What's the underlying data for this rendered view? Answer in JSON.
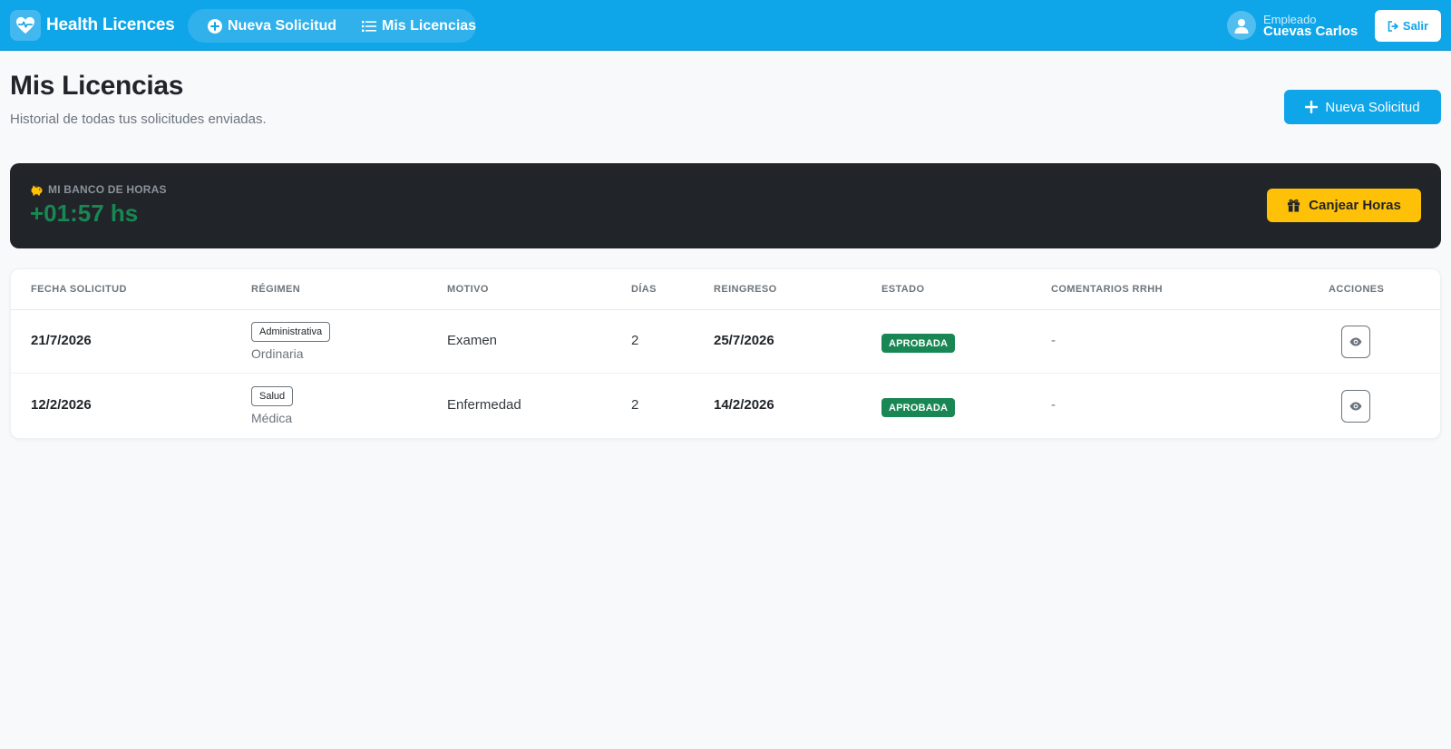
{
  "app": {
    "brand_name": "Health Licences",
    "nav": [
      {
        "label": "Nueva Solicitud",
        "icon": "plus-circle-icon"
      },
      {
        "label": "Mis Licencias",
        "icon": "list-icon"
      }
    ],
    "user": {
      "role": "Empleado",
      "name": "Cuevas Carlos",
      "icon": "user-icon"
    },
    "logout_label": "Salir",
    "accent_color": "#0ea5e9"
  },
  "header": {
    "title": "Mis Licencias",
    "subtitle": "Historial de todas tus solicitudes enviadas.",
    "new_button_label": "Nueva Solicitud"
  },
  "bank": {
    "label": "MI BANCO DE HORAS",
    "value": "+01:57 hs",
    "value_color": "#198754",
    "redeem_label": "Canjear Horas",
    "icon": "piggy-bank-icon"
  },
  "table": {
    "columns": [
      "FECHA SOLICITUD",
      "RÉGIMEN",
      "MOTIVO",
      "DÍAS",
      "REINGRESO",
      "ESTADO",
      "COMENTARIOS RRHH",
      "ACCIONES"
    ],
    "rows": [
      {
        "fecha": "21/7/2026",
        "regimen": "Administrativa",
        "regimen_sub": "Ordinaria",
        "motivo": "Examen",
        "dias": "2",
        "reingreso": "25/7/2026",
        "estado": "APROBADA",
        "comentarios": "-"
      },
      {
        "fecha": "12/2/2026",
        "regimen": "Salud",
        "regimen_sub": "Médica",
        "motivo": "Enfermedad",
        "dias": "2",
        "reingreso": "14/2/2026",
        "estado": "APROBADA",
        "comentarios": "-"
      }
    ],
    "status_color": "#198754"
  }
}
